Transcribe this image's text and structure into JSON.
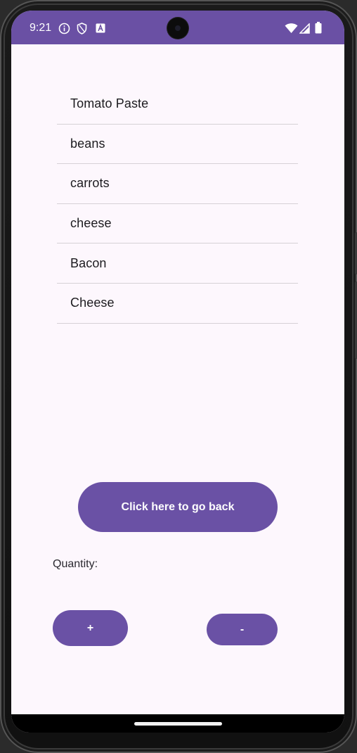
{
  "status_bar": {
    "time": "9:21",
    "left_icons": [
      "info-icon",
      "shield-icon",
      "keyboard-a-icon"
    ],
    "right_icons": [
      "wifi-icon",
      "signal-icon",
      "battery-icon"
    ],
    "color": "#6a50a4"
  },
  "grocery_list": {
    "items": [
      {
        "label": "Tomato Paste"
      },
      {
        "label": "beans"
      },
      {
        "label": "carrots"
      },
      {
        "label": "cheese"
      },
      {
        "label": "Bacon"
      },
      {
        "label": "Cheese"
      }
    ]
  },
  "actions": {
    "back_label": "Click here to go back",
    "quantity_label": "Quantity:",
    "increment_label": "+",
    "decrement_label": "-"
  },
  "theme": {
    "accent": "#6a51a5",
    "background": "#fdf7fd"
  }
}
